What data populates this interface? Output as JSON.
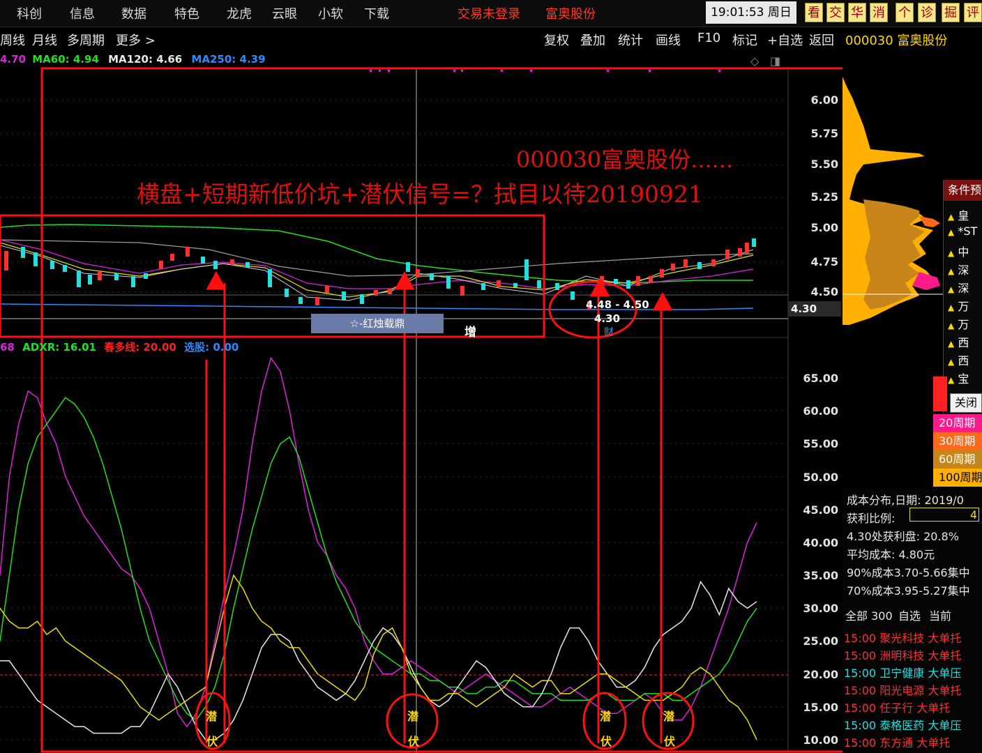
{
  "menu": {
    "items": [
      "科创",
      "信息",
      "数据",
      "特色",
      "龙虎",
      "云眼",
      "小软",
      "下载"
    ],
    "trade_status": "交易未登录",
    "stock_name": "富奥股份",
    "clock": "19:01:53",
    "weekday": "周日",
    "tool_buttons": [
      "看",
      "交",
      "华",
      "消",
      "个",
      "诊",
      "掘",
      "评"
    ]
  },
  "toolbar": {
    "left_items": [
      "周线",
      "月线",
      "多周期",
      "更多 >"
    ],
    "right_items": [
      "复权",
      "叠加",
      "统计",
      "画线",
      "F10",
      "标记",
      "+自选",
      "返回"
    ],
    "stock_code_name": "000030 富奥股份"
  },
  "ma_legend": [
    {
      "text": "4.70",
      "color": "#e020e0"
    },
    {
      "text": "MA60: 4.94",
      "color": "#20e020"
    },
    {
      "text": "MA120: 4.66",
      "color": "#e8e8e8"
    },
    {
      "text": "MA250: 4.39",
      "color": "#2a8cff"
    }
  ],
  "indicator_legend": [
    {
      "text": "68",
      "color": "#e020e0"
    },
    {
      "text": "ADXR: 16.01",
      "color": "#20e020"
    },
    {
      "text": "春多线: 20.00",
      "color": "#ff2020"
    },
    {
      "text": "选股: 0.00",
      "color": "#2a8cff"
    }
  ],
  "price_axis": [
    "6.00",
    "5.75",
    "5.50",
    "5.25",
    "5.00",
    "4.75",
    "4.50"
  ],
  "price_tag": "4.30",
  "indicator_axis": [
    "65.00",
    "60.00",
    "55.00",
    "50.00",
    "45.00",
    "40.00",
    "35.00",
    "30.00",
    "25.00",
    "20.00",
    "15.00",
    "10.00"
  ],
  "annotations": {
    "title": "000030富奥股份......",
    "subtitle": "横盘+短期新低价坑+潜伏信号=？拭目以待20190921"
  },
  "chart_labels": {
    "red_candle_label": "☆-红烛载鼎",
    "zeng": "增",
    "price_low": "4.48 - 4.50",
    "price_low2": "4.30",
    "cai": "财"
  },
  "condition_panel": {
    "title": "条件预",
    "items": [
      "皇",
      "*ST",
      "中",
      "深",
      "深",
      "万",
      "万",
      "西",
      "西",
      "宝"
    ],
    "close": "关闭",
    "periods": [
      {
        "label": "20周期",
        "color": "#ff1a8c"
      },
      {
        "label": "30周期",
        "color": "#ff6a1a"
      },
      {
        "label": "60周期",
        "color": "#c8861a"
      },
      {
        "label": "100周期",
        "color": "#ffb000"
      }
    ]
  },
  "cost_panel": {
    "date_label": "成本分布,日期:",
    "date_value": "2019/0",
    "profit_ratio_label": "获利比例:",
    "profit_ratio_value": "4",
    "profit_at": "4.30处获利盘: 20.8%",
    "avg_cost": "平均成本: 4.80元",
    "cost90": "90%成本3.70-5.66集中",
    "cost70": "70%成本3.95-5.27集中",
    "tabs": [
      "全部 300",
      "自选",
      "当前"
    ]
  },
  "stock_list": [
    {
      "time": "15:00",
      "name": "聚光科技",
      "type": "大单托",
      "color": "#ff3030"
    },
    {
      "time": "15:00",
      "name": "洲明科技",
      "type": "大单托",
      "color": "#ff3030"
    },
    {
      "time": "15:00",
      "name": "卫宁健康",
      "type": "大单压",
      "color": "#20e0e0"
    },
    {
      "time": "15:00",
      "name": "阳光电源",
      "type": "大单托",
      "color": "#ff3030"
    },
    {
      "time": "15:00",
      "name": "任子行",
      "type": "大单托",
      "color": "#ff3030"
    },
    {
      "time": "15:00",
      "name": "泰格医药",
      "type": "大单压",
      "color": "#20e0e0"
    },
    {
      "time": "15:00",
      "name": "东方通",
      "type": "大单托",
      "color": "#ff3030"
    }
  ],
  "signals": {
    "qian": "潜",
    "fu": "伏"
  },
  "chart_data": {
    "type": "line",
    "indicator_x_count": 90,
    "series": [
      {
        "color": "#e020e0",
        "values": [
          35,
          50,
          58,
          63,
          62,
          58,
          55,
          50,
          47,
          44,
          42,
          40,
          38,
          36,
          35,
          33,
          30,
          25,
          20,
          14,
          12,
          14,
          18,
          25,
          32,
          38,
          45,
          55,
          63,
          68,
          66,
          60,
          52,
          45,
          40,
          38,
          35,
          33,
          30,
          25,
          22,
          20,
          20,
          21,
          22,
          21,
          20,
          19,
          18,
          17,
          18,
          19,
          20,
          19,
          18,
          17,
          16,
          15,
          15,
          16,
          17,
          18,
          17,
          16,
          15,
          14,
          14,
          15,
          16,
          17,
          16,
          14,
          13,
          13,
          15,
          18,
          22,
          26,
          30,
          35,
          40,
          43
        ]
      },
      {
        "color": "#20e020",
        "values": [
          25,
          35,
          45,
          52,
          56,
          58,
          60,
          62,
          61,
          59,
          56,
          52,
          47,
          42,
          36,
          30,
          25,
          22,
          19,
          16,
          14,
          13,
          15,
          18,
          23,
          30,
          36,
          42,
          47,
          52,
          55,
          56,
          53,
          48,
          43,
          38,
          34,
          31,
          28,
          26,
          24,
          23,
          22,
          21,
          20,
          20,
          19,
          19,
          18,
          18,
          17,
          17,
          18,
          18,
          19,
          19,
          18,
          17,
          17,
          17,
          16,
          16,
          16,
          16,
          17,
          17,
          16,
          16,
          16,
          17,
          17,
          17,
          16,
          16,
          17,
          18,
          19,
          20,
          22,
          25,
          28,
          30
        ]
      },
      {
        "color": "#e8e8e8",
        "values": [
          22,
          22,
          20,
          18,
          16,
          15,
          14,
          13,
          12,
          12,
          11,
          11,
          11,
          11,
          12,
          12,
          14,
          17,
          20,
          18,
          15,
          12,
          10,
          10,
          11,
          13,
          16,
          20,
          24,
          26,
          26,
          25,
          22,
          20,
          18,
          17,
          16,
          17,
          19,
          22,
          25,
          27,
          26,
          24,
          21,
          18,
          16,
          15,
          16,
          18,
          20,
          22,
          21,
          19,
          17,
          16,
          15,
          15,
          17,
          20,
          24,
          27,
          27,
          25,
          22,
          20,
          18,
          18,
          19,
          21,
          24,
          26,
          27,
          28,
          30,
          34,
          32,
          29,
          33,
          31,
          30,
          31
        ]
      },
      {
        "color": "#e8e000",
        "values": [
          30,
          28,
          27,
          27,
          28,
          26,
          27,
          25,
          24,
          23,
          22,
          21,
          20,
          19,
          17,
          15,
          14,
          13,
          14,
          15,
          16,
          17,
          18,
          24,
          30,
          35,
          33,
          30,
          28,
          27,
          25,
          24,
          24,
          22,
          20,
          19,
          18,
          17,
          16,
          18,
          23,
          26,
          27,
          24,
          20,
          18,
          16,
          16,
          17,
          17,
          16,
          15,
          16,
          17,
          18,
          20,
          19,
          18,
          19,
          19,
          17,
          17,
          18,
          19,
          20,
          20,
          19,
          18,
          17,
          16,
          16,
          16,
          17,
          18,
          20,
          21,
          20,
          18,
          16,
          15,
          13,
          10
        ]
      }
    ]
  }
}
